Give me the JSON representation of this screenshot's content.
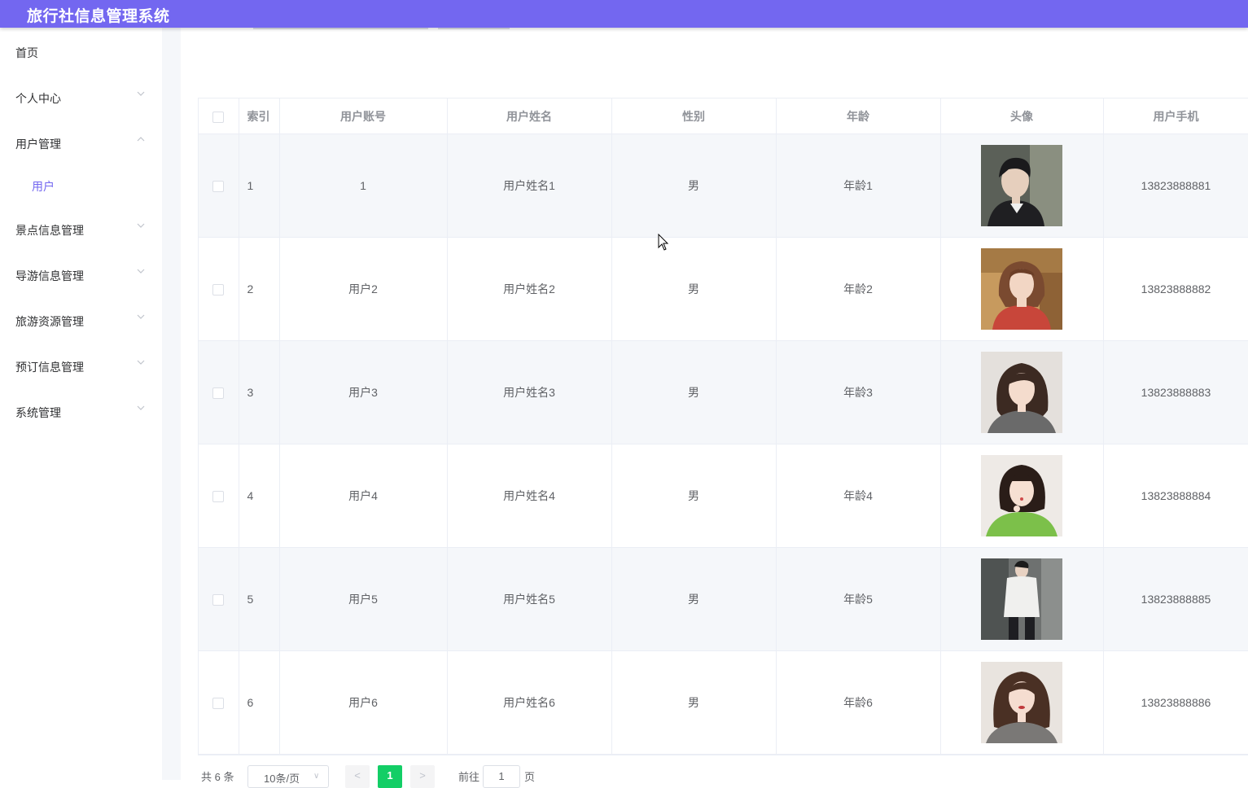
{
  "app": {
    "title": "旅行社信息管理系统"
  },
  "sidebar": {
    "items": [
      {
        "label": "首页",
        "chevron": "none"
      },
      {
        "label": "个人中心",
        "chevron": "down"
      },
      {
        "label": "用户管理",
        "chevron": "up"
      },
      {
        "label": "用户",
        "chevron": "none",
        "active": true
      },
      {
        "label": "景点信息管理",
        "chevron": "down"
      },
      {
        "label": "导游信息管理",
        "chevron": "down"
      },
      {
        "label": "旅游资源管理",
        "chevron": "down"
      },
      {
        "label": "预订信息管理",
        "chevron": "down"
      },
      {
        "label": "系统管理",
        "chevron": "down"
      }
    ]
  },
  "table": {
    "headers": [
      "索引",
      "用户账号",
      "用户姓名",
      "性别",
      "年龄",
      "头像",
      "用户手机"
    ],
    "rows": [
      {
        "index": "1",
        "account": "1",
        "name": "用户姓名1",
        "gender": "男",
        "age": "年龄1",
        "avatar": "avatar-photo",
        "phone": "13823888881"
      },
      {
        "index": "2",
        "account": "用户2",
        "name": "用户姓名2",
        "gender": "男",
        "age": "年龄2",
        "avatar": "avatar-photo",
        "phone": "13823888882"
      },
      {
        "index": "3",
        "account": "用户3",
        "name": "用户姓名3",
        "gender": "男",
        "age": "年龄3",
        "avatar": "avatar-photo",
        "phone": "13823888883"
      },
      {
        "index": "4",
        "account": "用户4",
        "name": "用户姓名4",
        "gender": "男",
        "age": "年龄4",
        "avatar": "avatar-photo",
        "phone": "13823888884"
      },
      {
        "index": "5",
        "account": "用户5",
        "name": "用户姓名5",
        "gender": "男",
        "age": "年龄5",
        "avatar": "avatar-photo",
        "phone": "13823888885"
      },
      {
        "index": "6",
        "account": "用户6",
        "name": "用户姓名6",
        "gender": "男",
        "age": "年龄6",
        "avatar": "avatar-photo",
        "phone": "13823888886"
      }
    ]
  },
  "pagination": {
    "total": "共 6 条",
    "page_size": "10条/页",
    "prev": "<",
    "current_page": "1",
    "next": ">",
    "goto_prefix": "前往",
    "goto_value": "1",
    "goto_suffix": "页"
  },
  "colors": {
    "header_bg": "#7367f0",
    "active_menu": "#7367f0",
    "active_page": "#13ce66"
  }
}
